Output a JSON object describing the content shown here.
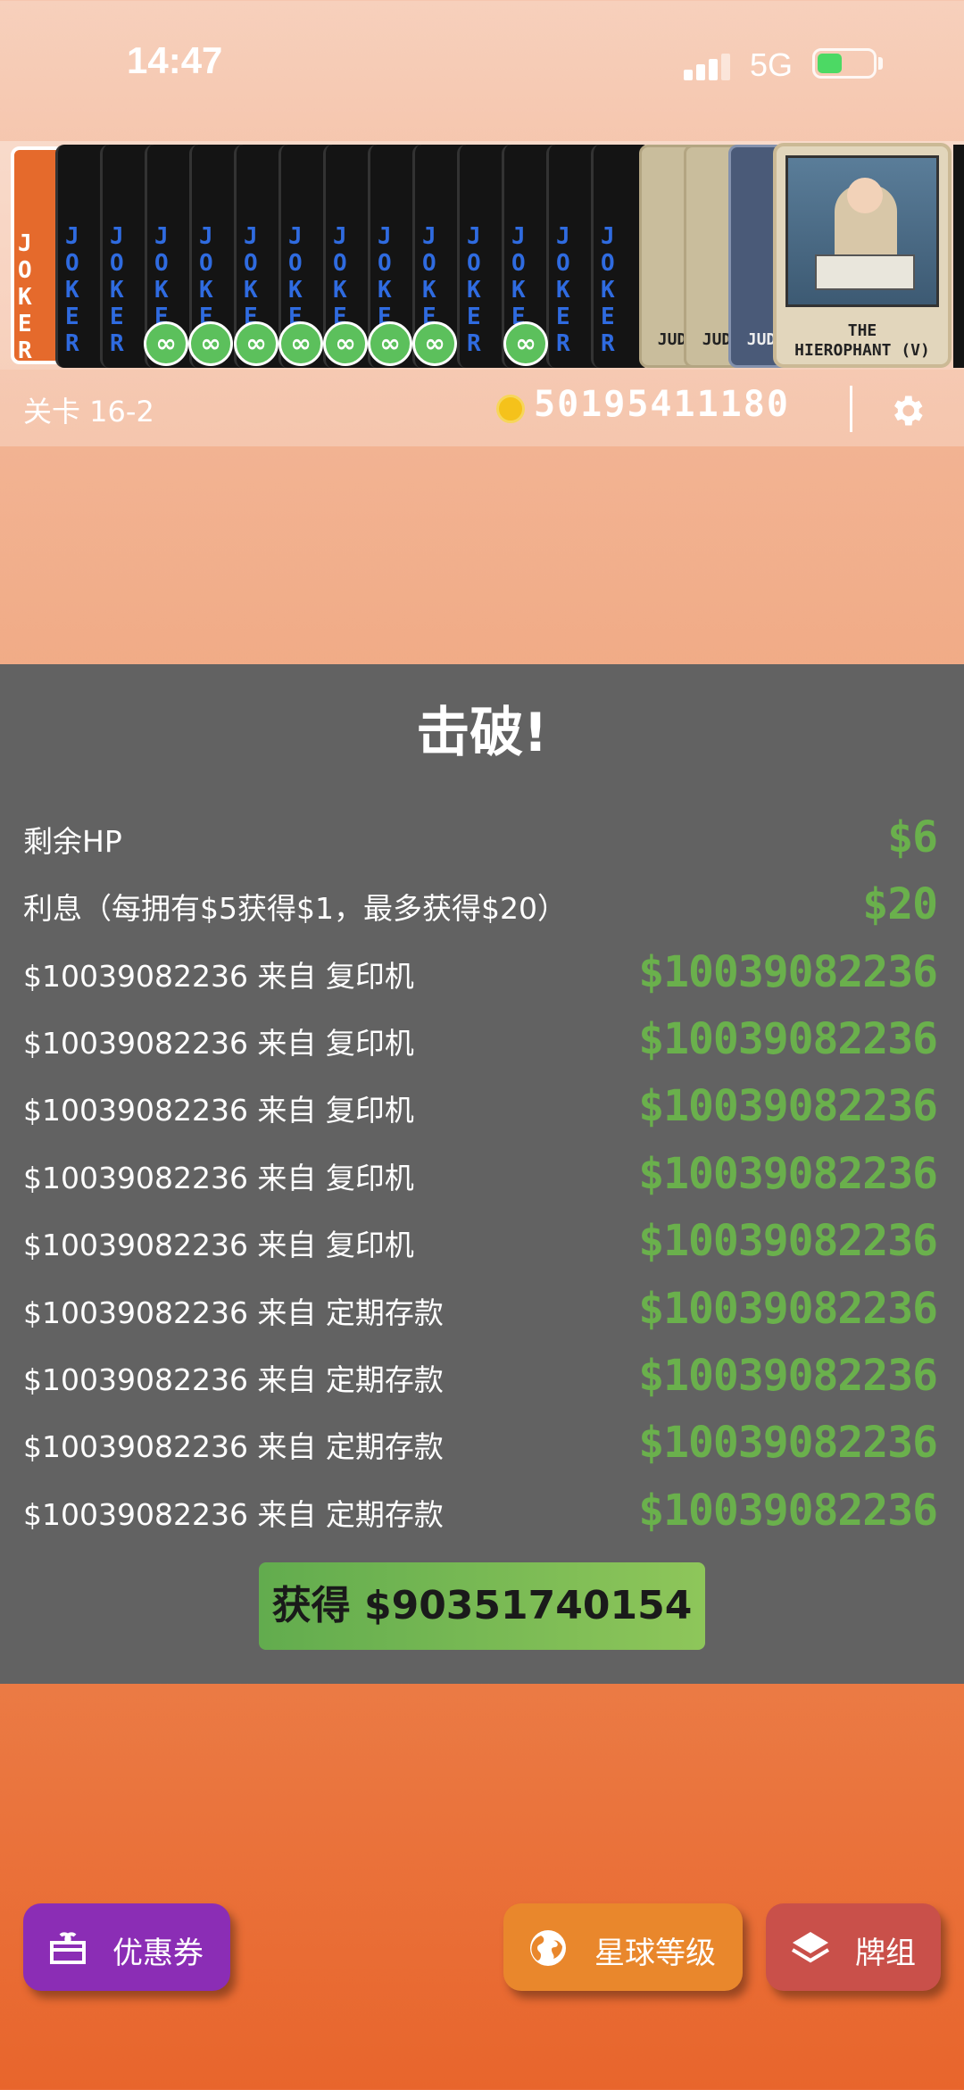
{
  "status_bar": {
    "time": "14:47",
    "network": "5G",
    "battery_level": 0.45
  },
  "card_strip": {
    "joker_text": "J\nO\nK\nE\nR",
    "badge_symbol": "∞",
    "tarot_cards": [
      "JUD",
      "JUD",
      "JUD"
    ],
    "featured_card": "THE\nHIEROPHANT (V)"
  },
  "level": {
    "label": "关卡 16-2"
  },
  "money": {
    "amount": "50195411180",
    "coin_icon": "coin-icon",
    "settings_icon": "gear-icon"
  },
  "results": {
    "title": "击破!",
    "rows": [
      {
        "label": "剩余HP",
        "value": "$6"
      },
      {
        "label": "利息（每拥有$5获得$1，最多获得$20）",
        "value": "$20"
      },
      {
        "label": "$10039082236 来自 复印机",
        "value": "$10039082236"
      },
      {
        "label": "$10039082236 来自 复印机",
        "value": "$10039082236"
      },
      {
        "label": "$10039082236 来自 复印机",
        "value": "$10039082236"
      },
      {
        "label": "$10039082236 来自 复印机",
        "value": "$10039082236"
      },
      {
        "label": "$10039082236 来自 复印机",
        "value": "$10039082236"
      },
      {
        "label": "$10039082236 来自 定期存款",
        "value": "$10039082236"
      },
      {
        "label": "$10039082236 来自 定期存款",
        "value": "$10039082236"
      },
      {
        "label": "$10039082236 来自 定期存款",
        "value": "$10039082236"
      },
      {
        "label": "$10039082236 来自 定期存款",
        "value": "$10039082236"
      }
    ],
    "earn_button": "获得 $90351740154"
  },
  "bottom_buttons": {
    "coupon": "优惠券",
    "planet": "星球等级",
    "deck": "牌组"
  },
  "colors": {
    "value_green": "#6ab04c",
    "panel_gray": "#626262",
    "coupon_purple": "#8b2db5",
    "planet_orange": "#e9872c",
    "deck_red": "#c9504a"
  }
}
